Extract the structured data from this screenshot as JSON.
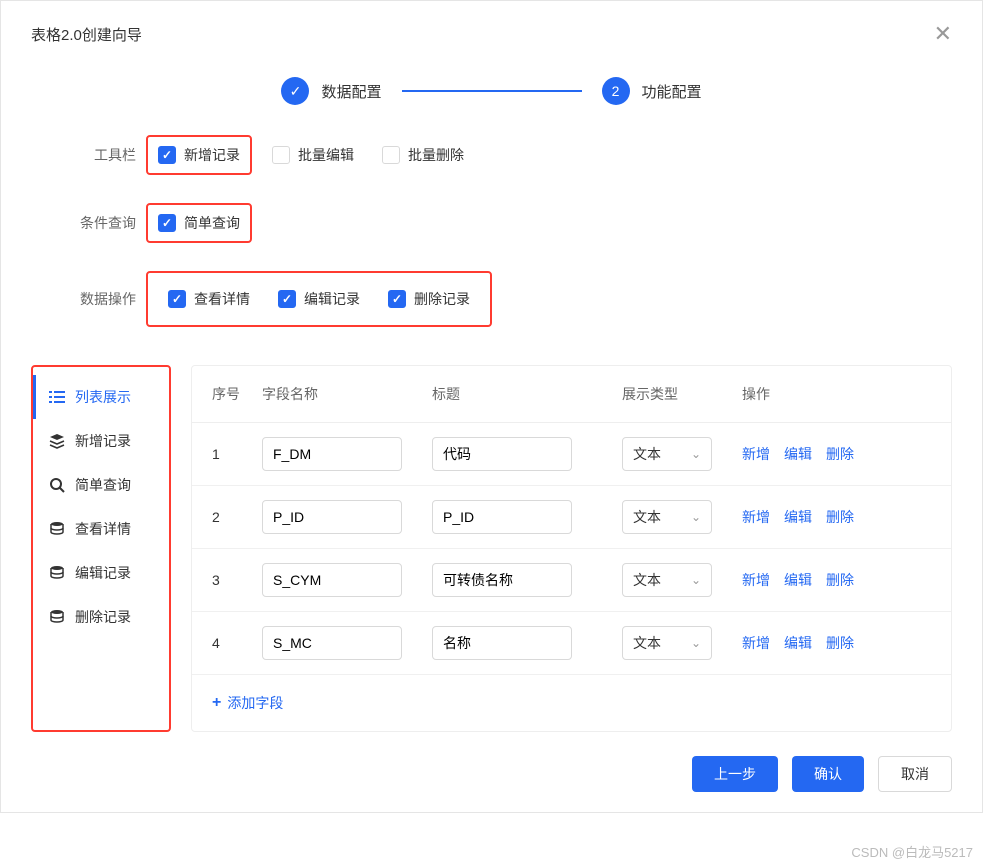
{
  "modal": {
    "title": "表格2.0创建向导"
  },
  "steps": {
    "step1": {
      "label": "数据配置"
    },
    "step2": {
      "number": "2",
      "label": "功能配置"
    }
  },
  "config": {
    "toolbar": {
      "label": "工具栏",
      "options": [
        {
          "label": "新增记录",
          "checked": true
        },
        {
          "label": "批量编辑",
          "checked": false
        },
        {
          "label": "批量删除",
          "checked": false
        }
      ]
    },
    "query": {
      "label": "条件查询",
      "options": [
        {
          "label": "简单查询",
          "checked": true
        }
      ]
    },
    "dataops": {
      "label": "数据操作",
      "options": [
        {
          "label": "查看详情",
          "checked": true
        },
        {
          "label": "编辑记录",
          "checked": true
        },
        {
          "label": "删除记录",
          "checked": true
        }
      ]
    }
  },
  "sidebar": {
    "items": [
      {
        "label": "列表展示",
        "icon": "list",
        "active": true
      },
      {
        "label": "新增记录",
        "icon": "stack",
        "active": false
      },
      {
        "label": "简单查询",
        "icon": "search",
        "active": false
      },
      {
        "label": "查看详情",
        "icon": "db",
        "active": false
      },
      {
        "label": "编辑记录",
        "icon": "db",
        "active": false
      },
      {
        "label": "删除记录",
        "icon": "db",
        "active": false
      }
    ]
  },
  "table": {
    "headers": {
      "seq": "序号",
      "field": "字段名称",
      "title": "标题",
      "type": "展示类型",
      "ops": "操作"
    },
    "rows": [
      {
        "seq": "1",
        "field": "F_DM",
        "title": "代码",
        "type": "文本"
      },
      {
        "seq": "2",
        "field": "P_ID",
        "title": "P_ID",
        "type": "文本"
      },
      {
        "seq": "3",
        "field": "S_CYM",
        "title": "可转债名称",
        "type": "文本"
      },
      {
        "seq": "4",
        "field": "S_MC",
        "title": "名称",
        "type": "文本"
      }
    ],
    "rowOps": {
      "add": "新增",
      "edit": "编辑",
      "delete": "删除"
    },
    "addField": "添加字段"
  },
  "footer": {
    "prev": "上一步",
    "confirm": "确认",
    "cancel": "取消"
  },
  "watermark": "CSDN @白龙马5217"
}
